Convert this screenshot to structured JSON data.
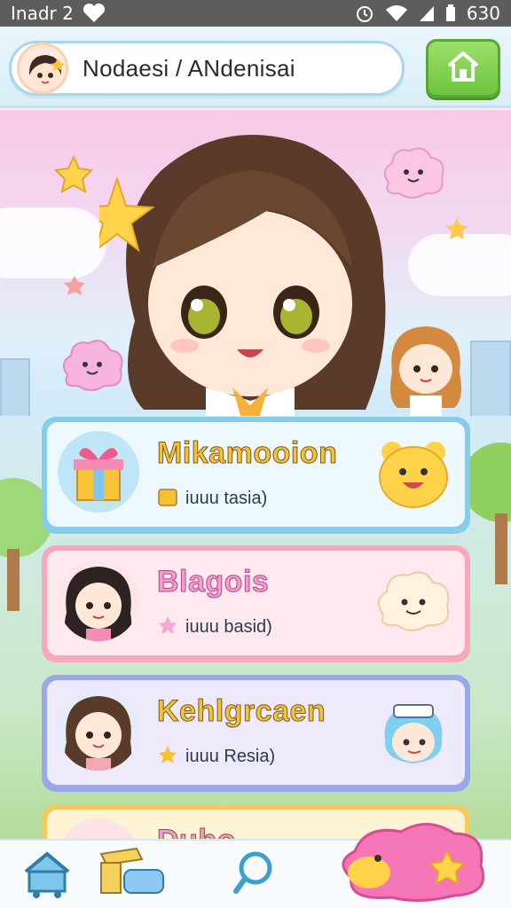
{
  "status_bar": {
    "carrier": "Inadr 2",
    "time": "630",
    "icons": [
      "heart-icon",
      "alarm-icon",
      "wifi-icon",
      "signal-icon",
      "battery-icon"
    ]
  },
  "header": {
    "search_text": "Nodaesi / ANdenisai",
    "home_icon": "home-icon"
  },
  "cards": [
    {
      "title": "Mikamooion",
      "subtitle": "iuuu tasia)",
      "theme": "blue",
      "title_color": "#f5c234"
    },
    {
      "title": "Blagois",
      "subtitle": "iuuu basid)",
      "theme": "pink",
      "title_color": "#f59bd0"
    },
    {
      "title": "Kehlgrcaen",
      "subtitle": "iuuu Resia)",
      "theme": "lavender",
      "title_color": "#f5c234"
    },
    {
      "title": "Dubo",
      "subtitle": "",
      "theme": "yellow",
      "title_color": "#f59bd0"
    }
  ],
  "bottom_nav": {
    "items": [
      "home-cart-icon",
      "games-icon",
      "search-icon",
      "cloud-mascot-icon"
    ]
  },
  "colors": {
    "accent_green": "#6cc540",
    "accent_blue": "#a9d6ea",
    "card_blue": "#eaf7fd",
    "card_pink": "#fde6ec",
    "card_lavender": "#ece6fb"
  }
}
